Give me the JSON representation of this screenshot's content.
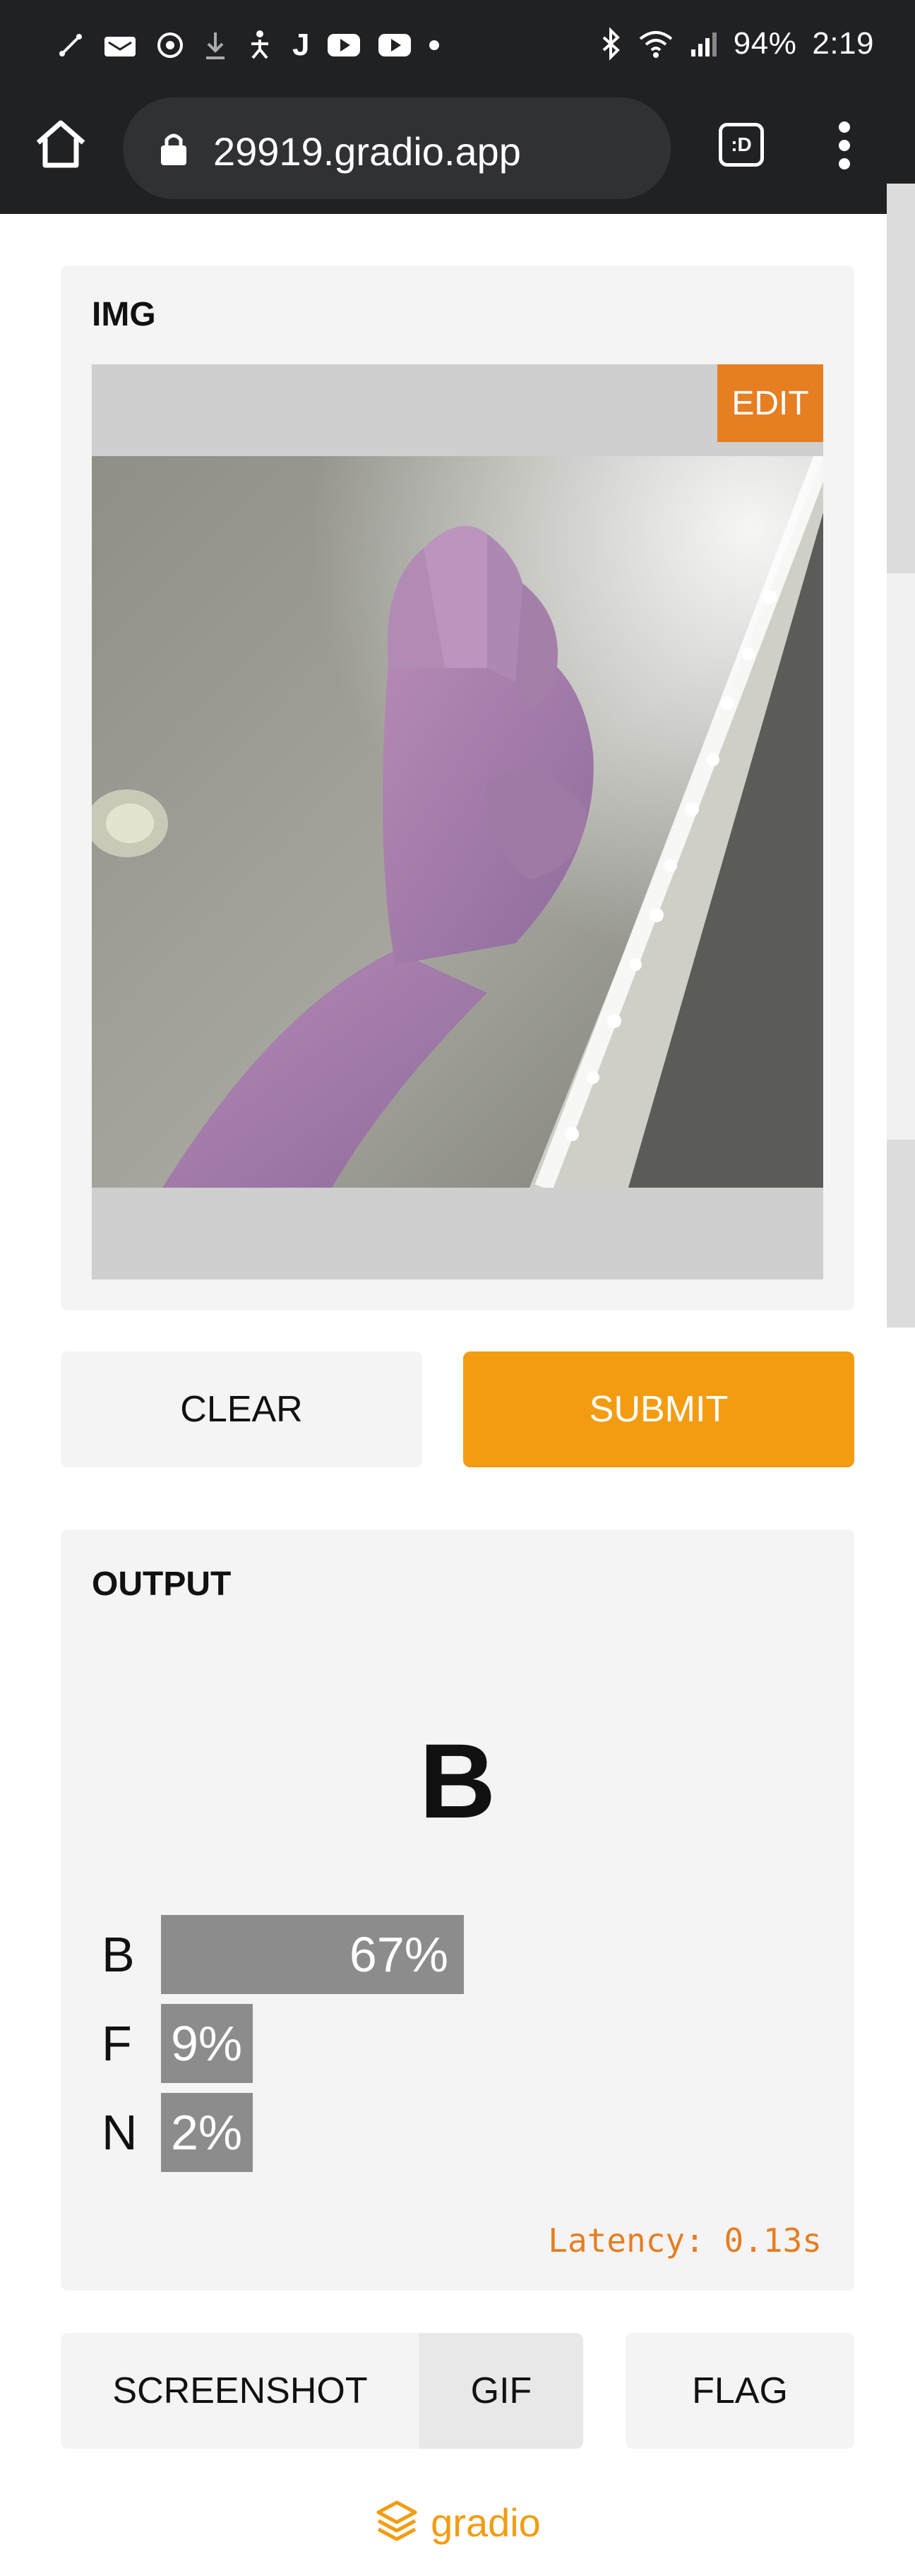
{
  "status_bar": {
    "left_icons": [
      "link-icon",
      "message-icon",
      "sync-icon",
      "download-icon",
      "accessibility-icon",
      "j-app-icon",
      "youtube-icon",
      "youtube-icon",
      "dot-icon"
    ],
    "j_glyph": "J",
    "battery": "94%",
    "time": "2:19"
  },
  "browser": {
    "url": "29919.gradio.app",
    "tab_switcher_label": ":D"
  },
  "input_panel": {
    "label": "IMG",
    "edit_label": "EDIT"
  },
  "actions": {
    "clear_label": "CLEAR",
    "submit_label": "SUBMIT"
  },
  "output_panel": {
    "label": "OUTPUT",
    "predicted": "B",
    "confidences": [
      {
        "name": "B",
        "value": 0.67,
        "text": "67%"
      },
      {
        "name": "F",
        "value": 0.09,
        "text": "9%"
      },
      {
        "name": "N",
        "value": 0.02,
        "text": "2%"
      }
    ],
    "latency": "Latency: 0.13s"
  },
  "bottom": {
    "screenshot_label": "SCREENSHOT",
    "gif_label": "GIF",
    "flag_label": "FLAG"
  },
  "footer": {
    "brand": "gradio"
  },
  "colors": {
    "accent_orange": "#f39c12",
    "edit_orange": "#e67e22",
    "chrome_dark": "#202124",
    "bar_gray": "#8c8c8c"
  }
}
